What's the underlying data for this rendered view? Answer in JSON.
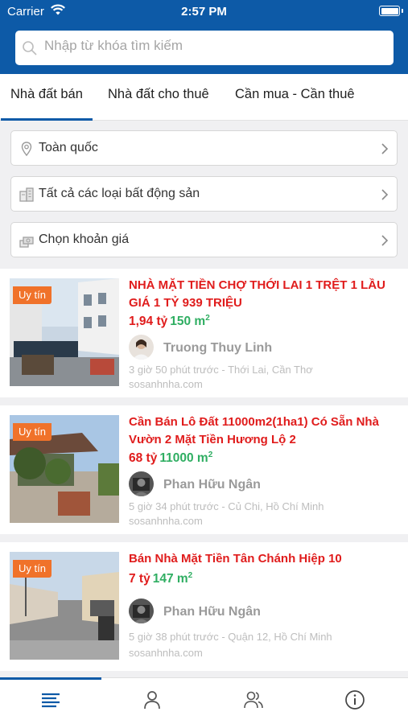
{
  "status_bar": {
    "carrier": "Carrier",
    "time": "2:57 PM"
  },
  "search": {
    "placeholder": "Nhập từ khóa tìm kiếm"
  },
  "tabs": [
    {
      "label": "Nhà đất bán",
      "active": true
    },
    {
      "label": "Nhà đất cho thuê",
      "active": false
    },
    {
      "label": "Cần mua - Cần thuê",
      "active": false
    }
  ],
  "filters": [
    {
      "label": "Toàn quốc",
      "icon": "location-pin-icon"
    },
    {
      "label": "Tất cả các loại bất động sản",
      "icon": "building-icon"
    },
    {
      "label": "Chọn khoản giá",
      "icon": "money-icon"
    }
  ],
  "listings": [
    {
      "badge": "Uy tín",
      "title": "NHÀ MẶT TIỀN CHỢ THỚI LAI 1 TRỆT 1 LẦU GIÁ 1 TỶ 939 TRIỆU",
      "price": "1,94 tỷ",
      "area": "150 m",
      "area_sup": "2",
      "user": "Truong Thuy Linh",
      "meta": "3 giờ 50 phút trước - Thới Lai, Cần Thơ",
      "site": "sosanhnha.com"
    },
    {
      "badge": "Uy tín",
      "title": "Cần Bán Lô Đất 11000m2(1ha1) Có Sẵn Nhà Vườn 2 Mặt Tiền Hương Lộ 2",
      "price": "68 tỷ",
      "area": "11000 m",
      "area_sup": "2",
      "user": "Phan Hữu Ngân",
      "meta": "5 giờ 34 phút trước - Củ Chi, Hồ Chí Minh",
      "site": "sosanhnha.com"
    },
    {
      "badge": "Uy tín",
      "title": "Bán Nhà Mặt Tiền Tân Chánh Hiệp 10",
      "price": "7 tỷ",
      "area": "147 m",
      "area_sup": "2",
      "user": "Phan Hữu Ngân",
      "meta": "5 giờ 38 phút trước - Quận 12, Hồ Chí Minh",
      "site": "sosanhnha.com"
    }
  ],
  "bottom_nav": [
    {
      "icon": "list-icon",
      "active": true
    },
    {
      "icon": "person-icon",
      "active": false
    },
    {
      "icon": "people-icon",
      "active": false
    },
    {
      "icon": "info-icon",
      "active": false
    }
  ],
  "colors": {
    "primary": "#0d5aa7",
    "price_red": "#e01c1c",
    "area_green": "#2fae62",
    "badge_orange": "#f0722a"
  }
}
